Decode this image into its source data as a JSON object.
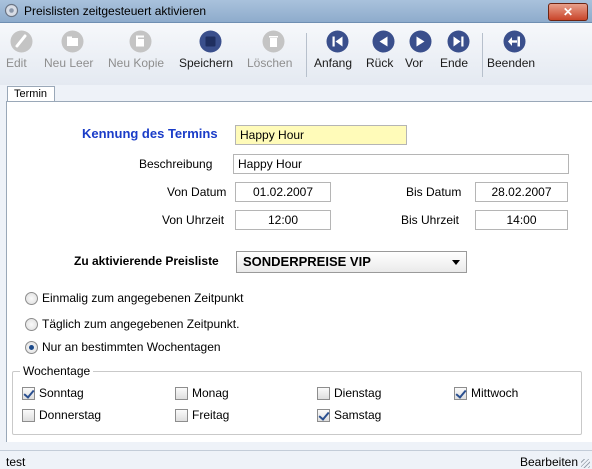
{
  "window": {
    "title": "Preislisten zeitgesteuert aktivieren",
    "close_label": "✕"
  },
  "toolbar": {
    "edit": "Edit",
    "neu_leer": "Neu Leer",
    "neu_kopie": "Neu Kopie",
    "speichern": "Speichern",
    "loeschen": "Löschen",
    "anfang": "Anfang",
    "rueck": "Rück",
    "vor": "Vor",
    "ende": "Ende",
    "beenden": "Beenden"
  },
  "tabs": [
    {
      "label": "Termin"
    }
  ],
  "form": {
    "kennung_label": "Kennung des Termins",
    "kennung_value": "Happy Hour",
    "beschreibung_label": "Beschreibung",
    "beschreibung_value": "Happy Hour",
    "von_datum_label": "Von Datum",
    "von_datum_value": "01.02.2007",
    "bis_datum_label": "Bis Datum",
    "bis_datum_value": "28.02.2007",
    "von_uhrzeit_label": "Von Uhrzeit",
    "von_uhrzeit_value": "12:00",
    "bis_uhrzeit_label": "Bis Uhrzeit",
    "bis_uhrzeit_value": "14:00",
    "preisliste_label": "Zu aktivierende Preisliste",
    "preisliste_value": "SONDERPREISE VIP"
  },
  "modes": [
    {
      "label": "Einmalig zum angegebenen Zeitpunkt",
      "selected": false
    },
    {
      "label": "Täglich zum angegebenen Zeitpunkt.",
      "selected": false
    },
    {
      "label": "Nur an bestimmten Wochentagen",
      "selected": true
    }
  ],
  "weekdays": {
    "title": "Wochentage",
    "days": [
      {
        "label": "Sonntag",
        "checked": true
      },
      {
        "label": "Monag",
        "checked": false
      },
      {
        "label": "Dienstag",
        "checked": false
      },
      {
        "label": "Mittwoch",
        "checked": true
      },
      {
        "label": "Donnerstag",
        "checked": false
      },
      {
        "label": "Freitag",
        "checked": false
      },
      {
        "label": "Samstag",
        "checked": true
      }
    ]
  },
  "status": {
    "left": "test",
    "right": "Bearbeiten"
  },
  "colors": {
    "accent_label": "#1a3cc8",
    "yellow_field": "#fffbb9",
    "tool_icon": "#3a4f8c"
  }
}
